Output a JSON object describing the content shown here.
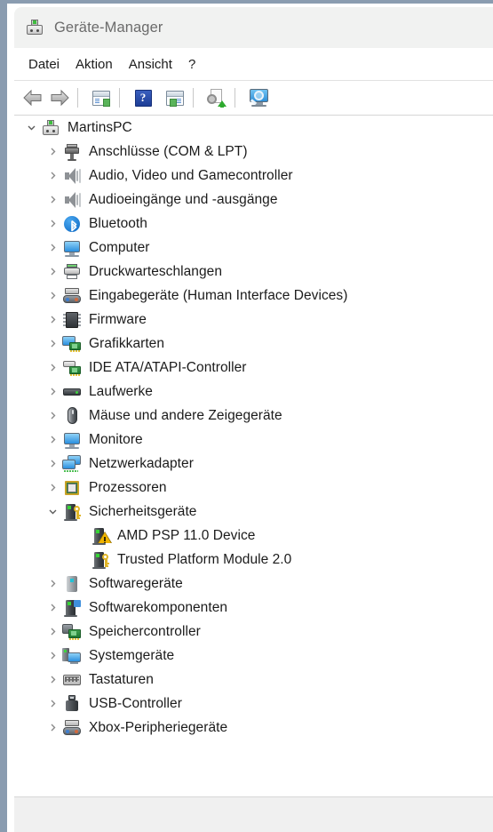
{
  "window": {
    "title": "Geräte-Manager",
    "title_icon": "device-manager-icon"
  },
  "menubar": {
    "items": [
      {
        "label": "Datei"
      },
      {
        "label": "Aktion"
      },
      {
        "label": "Ansicht"
      },
      {
        "label": "?"
      }
    ]
  },
  "toolbar": {
    "buttons": [
      {
        "name": "back-button",
        "icon": "back-arrow-icon",
        "label": ""
      },
      {
        "name": "forward-button",
        "icon": "forward-arrow-icon",
        "label": ""
      },
      {
        "name": "show-hide-console-tree-button",
        "icon": "console-tree-icon",
        "label": ""
      },
      {
        "name": "help-button",
        "icon": "help-question-icon",
        "label": "?"
      },
      {
        "name": "properties-button",
        "icon": "properties-window-icon",
        "label": ""
      },
      {
        "name": "update-driver-button",
        "icon": "update-driver-icon",
        "label": ""
      },
      {
        "name": "scan-for-hardware-changes-button",
        "icon": "scan-hardware-icon",
        "label": ""
      }
    ]
  },
  "tree": {
    "nodes": [
      {
        "label": "MartinsPC",
        "level": 0,
        "twisty": "expanded",
        "icon": "computer-root-icon"
      },
      {
        "label": "Anschlüsse (COM & LPT)",
        "level": 1,
        "twisty": "collapsed",
        "icon": "port-icon"
      },
      {
        "label": "Audio, Video und Gamecontroller",
        "level": 1,
        "twisty": "collapsed",
        "icon": "speaker-icon"
      },
      {
        "label": "Audioeingänge und -ausgänge",
        "level": 1,
        "twisty": "collapsed",
        "icon": "speaker-icon"
      },
      {
        "label": "Bluetooth",
        "level": 1,
        "twisty": "collapsed",
        "icon": "bluetooth-icon"
      },
      {
        "label": "Computer",
        "level": 1,
        "twisty": "collapsed",
        "icon": "monitor-icon"
      },
      {
        "label": "Druckwarteschlangen",
        "level": 1,
        "twisty": "collapsed",
        "icon": "printer-icon"
      },
      {
        "label": "Eingabegeräte (Human Interface Devices)",
        "level": 1,
        "twisty": "collapsed",
        "icon": "hid-gamepad-icon"
      },
      {
        "label": "Firmware",
        "level": 1,
        "twisty": "collapsed",
        "icon": "firmware-chip-icon"
      },
      {
        "label": "Grafikkarten",
        "level": 1,
        "twisty": "collapsed",
        "icon": "display-adapter-icon"
      },
      {
        "label": "IDE ATA/ATAPI-Controller",
        "level": 1,
        "twisty": "collapsed",
        "icon": "ide-controller-icon"
      },
      {
        "label": "Laufwerke",
        "level": 1,
        "twisty": "collapsed",
        "icon": "disk-drive-icon"
      },
      {
        "label": "Mäuse und andere Zeigegeräte",
        "level": 1,
        "twisty": "collapsed",
        "icon": "mouse-icon"
      },
      {
        "label": "Monitore",
        "level": 1,
        "twisty": "collapsed",
        "icon": "monitor-icon"
      },
      {
        "label": "Netzwerkadapter",
        "level": 1,
        "twisty": "collapsed",
        "icon": "network-adapter-icon"
      },
      {
        "label": "Prozessoren",
        "level": 1,
        "twisty": "collapsed",
        "icon": "processor-icon"
      },
      {
        "label": "Sicherheitsgeräte",
        "level": 1,
        "twisty": "expanded",
        "icon": "security-device-icon"
      },
      {
        "label": "AMD PSP 11.0 Device",
        "level": 2,
        "twisty": "none",
        "icon": "security-device-warning-icon"
      },
      {
        "label": "Trusted Platform Module 2.0",
        "level": 2,
        "twisty": "none",
        "icon": "security-device-icon"
      },
      {
        "label": "Softwaregeräte",
        "level": 1,
        "twisty": "collapsed",
        "icon": "software-device-icon"
      },
      {
        "label": "Softwarekomponenten",
        "level": 1,
        "twisty": "collapsed",
        "icon": "software-component-icon"
      },
      {
        "label": "Speichercontroller",
        "level": 1,
        "twisty": "collapsed",
        "icon": "storage-controller-icon"
      },
      {
        "label": "Systemgeräte",
        "level": 1,
        "twisty": "collapsed",
        "icon": "system-device-icon"
      },
      {
        "label": "Tastaturen",
        "level": 1,
        "twisty": "collapsed",
        "icon": "keyboard-icon"
      },
      {
        "label": "USB-Controller",
        "level": 1,
        "twisty": "collapsed",
        "icon": "usb-icon"
      },
      {
        "label": "Xbox-Peripheriegeräte",
        "level": 1,
        "twisty": "collapsed",
        "icon": "hid-gamepad-icon"
      }
    ]
  },
  "statusbar": {
    "text": ""
  },
  "colors": {
    "window_frame": "#8a9cb0",
    "titlebar_bg": "#f1f2f1",
    "title_text": "#6b6b6b",
    "menu_text": "#1c1c1c",
    "tree_text": "#1b1b1b",
    "statusbar_bg": "#f0f0f0",
    "accent_blue": "#2a8ede",
    "warning_yellow": "#f0b400",
    "key_gold": "#e0b528",
    "led_green": "#36d336"
  }
}
